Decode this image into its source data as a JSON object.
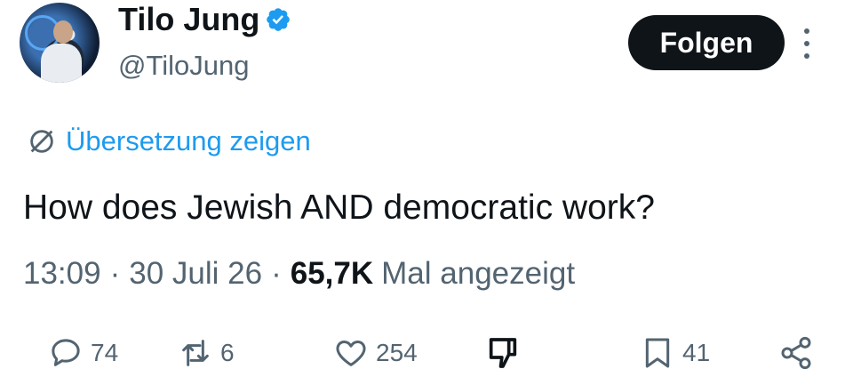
{
  "author": {
    "name": "Tilo Jung",
    "handle": "@TiloJung",
    "verified": true
  },
  "follow_button_label": "Folgen",
  "translate_label": "Übersetzung zeigen",
  "tweet_text": "How does Jewish AND democratic work?",
  "meta": {
    "time": "13:09",
    "date": "30 Juli 26",
    "views_count": "65,7K",
    "views_label": "Mal angezeigt"
  },
  "actions": {
    "replies": "74",
    "reposts": "6",
    "likes": "254",
    "bookmarks": "41"
  },
  "colors": {
    "accent": "#1d9bf0",
    "text": "#0f1419",
    "secondary": "#536471"
  }
}
